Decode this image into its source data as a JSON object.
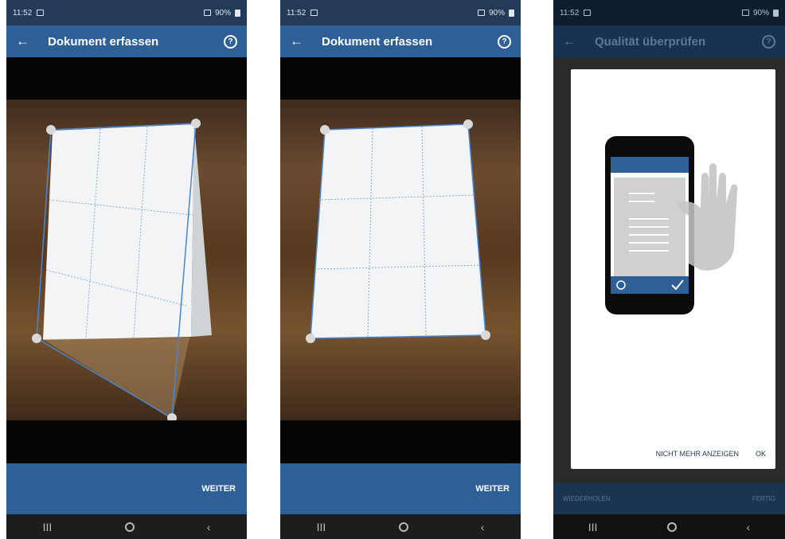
{
  "screens": [
    {
      "status_time": "11:52",
      "battery": "90%",
      "title": "Dokument erfassen",
      "back_icon": "arrow-left-icon",
      "help_icon": "help-circle-icon",
      "action": "WEITER"
    },
    {
      "status_time": "11:52",
      "battery": "90%",
      "title": "Dokument erfassen",
      "back_icon": "arrow-left-icon",
      "help_icon": "help-circle-icon",
      "action": "WEITER"
    },
    {
      "status_time": "11:52",
      "battery": "90%",
      "title": "Qualität überprüfen",
      "dialog": {
        "text": "",
        "dont_show": "NICHT MEHR ANZEIGEN",
        "ok": "OK"
      },
      "left_action": "WIEDERHOLEN",
      "right_action": "FERTIG"
    }
  ],
  "navbar": {
    "recents": "III",
    "home": "home-circle-icon",
    "back": "‹"
  },
  "colors": {
    "app_bar": "#2f5f97",
    "status_bar": "#233a58",
    "handle": "#d9d9d9",
    "outline": "#4a86cf"
  }
}
